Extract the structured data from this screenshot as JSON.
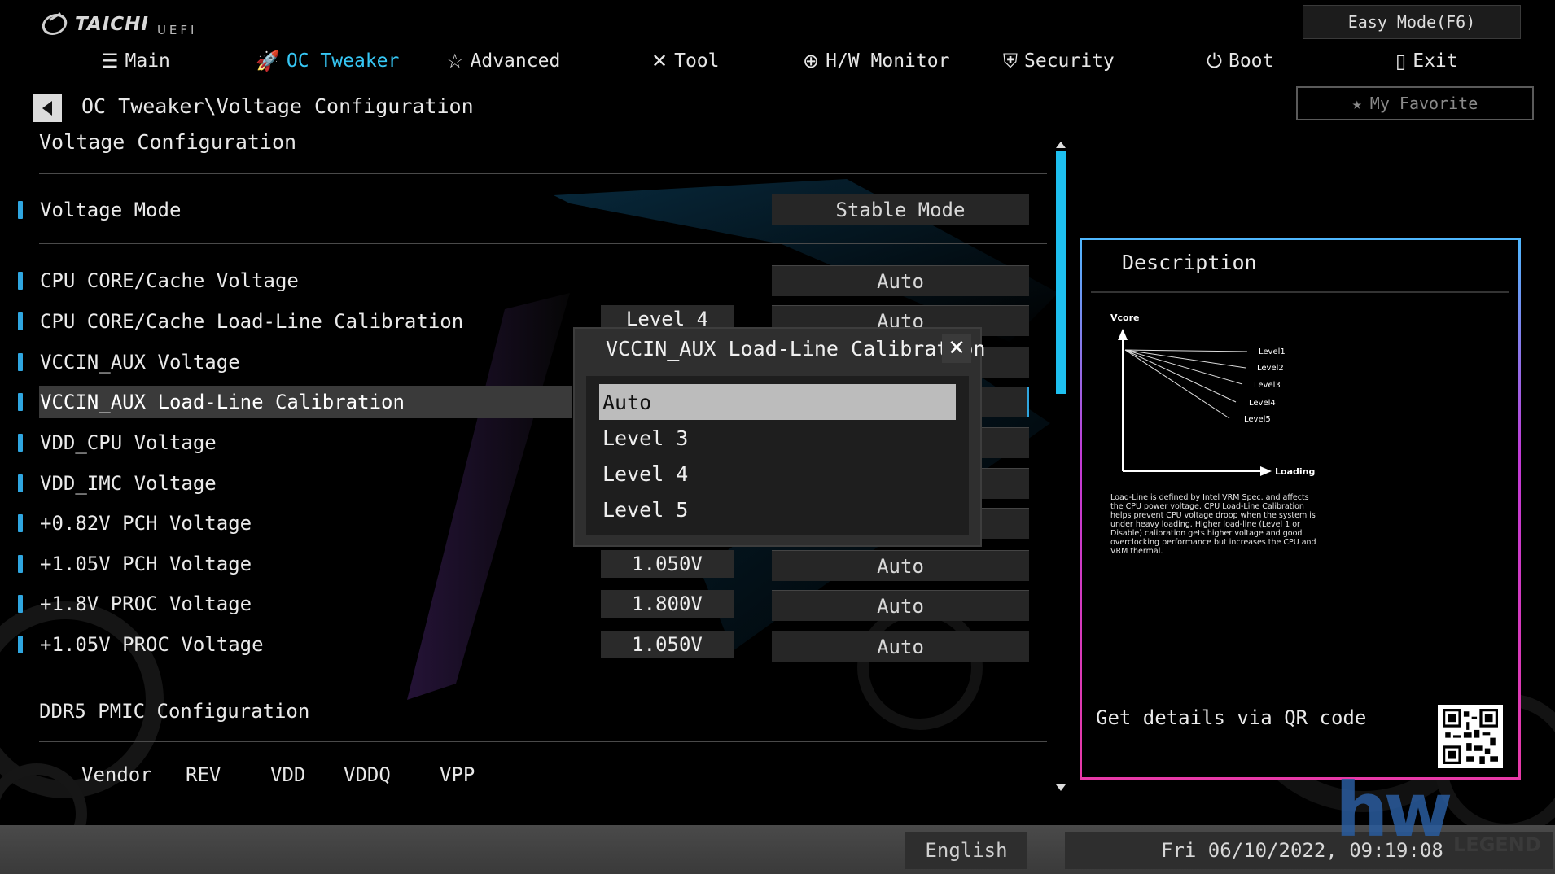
{
  "brand": {
    "name": "TAICHI",
    "sub": "UEFI"
  },
  "nav": {
    "tabs": [
      {
        "label": "Main",
        "icon": "list-icon"
      },
      {
        "label": "OC Tweaker",
        "icon": "rocket-icon",
        "active": true
      },
      {
        "label": "Advanced",
        "icon": "star-advanced-icon"
      },
      {
        "label": "Tool",
        "icon": "tools-icon"
      },
      {
        "label": "H/W Monitor",
        "icon": "monitor-target-icon"
      },
      {
        "label": "Security",
        "icon": "shield-icon"
      },
      {
        "label": "Boot",
        "icon": "power-icon"
      },
      {
        "label": "Exit",
        "icon": "exit-door-icon"
      }
    ],
    "easy_mode": "Easy Mode(F6)",
    "my_favorite": "My Favorite"
  },
  "breadcrumb": "OC Tweaker\\Voltage Configuration",
  "section_title": "Voltage Configuration",
  "voltage_mode": {
    "label": "Voltage Mode",
    "value": "Stable Mode"
  },
  "rows": [
    {
      "label": "CPU CORE/Cache Voltage",
      "current": "",
      "setting": "Auto"
    },
    {
      "label": "CPU CORE/Cache Load-Line Calibration",
      "current": "Level 4",
      "setting": "Auto"
    },
    {
      "label": "VCCIN_AUX Voltage",
      "current": "",
      "setting": "Auto"
    },
    {
      "label": "VCCIN_AUX Load-Line Calibration",
      "current": "",
      "setting": ""
    },
    {
      "label": "VDD_CPU Voltage",
      "current": "",
      "setting": ""
    },
    {
      "label": "VDD_IMC Voltage",
      "current": "",
      "setting": ""
    },
    {
      "label": "+0.82V PCH Voltage",
      "current": "",
      "setting": ""
    },
    {
      "label": "+1.05V PCH Voltage",
      "current": "1.050V",
      "setting": "Auto"
    },
    {
      "label": "+1.8V PROC Voltage",
      "current": "1.800V",
      "setting": "Auto"
    },
    {
      "label": "+1.05V PROC Voltage",
      "current": "1.050V",
      "setting": "Auto"
    }
  ],
  "pmic": {
    "title": "DDR5 PMIC Configuration",
    "columns": [
      "Vendor",
      "REV",
      "VDD",
      "VDDQ",
      "VPP"
    ]
  },
  "popup": {
    "title": "VCCIN_AUX Load-Line Calibration",
    "options": [
      "Auto",
      "Level 3",
      "Level 4",
      "Level 5"
    ],
    "selected": "Auto"
  },
  "description": {
    "title": "Description",
    "chart_y_label": "Vcore",
    "chart_x_label": "Loading",
    "levels": [
      "Level1",
      "Level2",
      "Level3",
      "Level4",
      "Level5"
    ],
    "text": "Load-Line is defined by Intel VRM Spec. and affects the CPU power voltage. CPU Load-Line Calibration helps prevent CPU voltage droop when the system is under heavy loading. Higher load-line (Level 1 or Disable) calibration gets higher voltage and good overclocking performance but increases the CPU and VRM thermal.",
    "qr_label": "Get details via QR code"
  },
  "status": {
    "language": "English",
    "datetime": "Fri 06/10/2022, 09:19:08"
  },
  "watermark": {
    "logo": "hw",
    "sub": "LEGEND"
  },
  "colors": {
    "accent": "#36c6f4",
    "marker": "#2fa6e0",
    "panel_border_top": "#4fb8ff",
    "panel_border_bottom": "#e83aa8"
  }
}
